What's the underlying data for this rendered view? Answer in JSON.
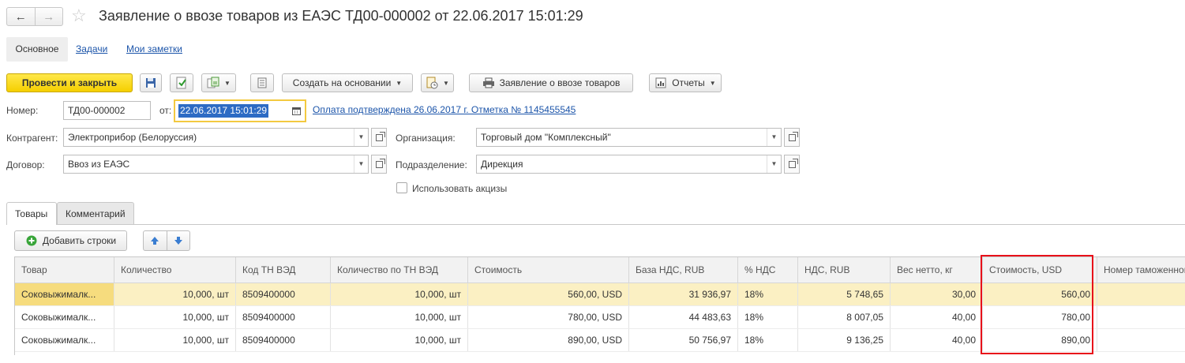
{
  "window": {
    "title": "Заявление о ввозе товаров из ЕАЭС ТД00-000002 от 22.06.2017 15:01:29",
    "back_icon": "arrow-left",
    "forward_icon": "arrow-right",
    "favorite_icon": "star"
  },
  "section_tabs": [
    {
      "label": "Основное"
    },
    {
      "label": "Задачи"
    },
    {
      "label": "Мои заметки"
    }
  ],
  "toolbar": {
    "post_close_label": "Провести и закрыть",
    "create_based_label": "Создать на основании",
    "application_label": "Заявление о ввозе товаров",
    "reports_label": "Отчеты"
  },
  "form": {
    "number_label": "Номер:",
    "number_value": "ТД00-000002",
    "from_label": "от:",
    "date_value": "22.06.2017 15:01:29",
    "payment_link": "Оплата подтверждена 26.06.2017 г. Отметка № 1145455545",
    "contractor_label": "Контрагент:",
    "contractor_value": "Электроприбор (Белоруссия)",
    "organization_label": "Организация:",
    "organization_value": "Торговый дом \"Комплексный\"",
    "contract_label": "Договор:",
    "contract_value": "Ввоз из ЕАЭС",
    "department_label": "Подразделение:",
    "department_value": "Дирекция",
    "excise_label": "Использовать акцизы",
    "excise_checked": false
  },
  "content_tabs": [
    {
      "label": "Товары"
    },
    {
      "label": "Комментарий"
    }
  ],
  "table_toolbar": {
    "add_rows_label": "Добавить строки"
  },
  "table": {
    "columns": [
      "Товар",
      "Количество",
      "Код ТН ВЭД",
      "Количество по ТН ВЭД",
      "Стоимость",
      "База НДС, RUB",
      "% НДС",
      "НДС, RUB",
      "Вес нетто, кг",
      "Стоимость, USD",
      "Номер таможенной"
    ],
    "rows": [
      [
        "Соковыжималк...",
        "10,000, шт",
        "8509400000",
        "10,000, шт",
        "560,00, USD",
        "31 936,97",
        "18%",
        "5 748,65",
        "30,00",
        "560,00",
        ""
      ],
      [
        "Соковыжималк...",
        "10,000, шт",
        "8509400000",
        "10,000, шт",
        "780,00, USD",
        "44 483,63",
        "18%",
        "8 007,05",
        "40,00",
        "780,00",
        ""
      ],
      [
        "Соковыжималк...",
        "10,000, шт",
        "8509400000",
        "10,000, шт",
        "890,00, USD",
        "50 756,97",
        "18%",
        "9 136,25",
        "40,00",
        "890,00",
        ""
      ]
    ],
    "selected_row": 0,
    "highlight_color": "#e8101a"
  }
}
